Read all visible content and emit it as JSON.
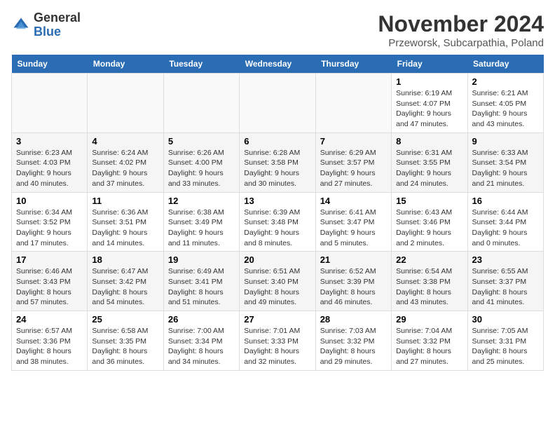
{
  "logo": {
    "general": "General",
    "blue": "Blue"
  },
  "header": {
    "month": "November 2024",
    "location": "Przeworsk, Subcarpathia, Poland"
  },
  "days_of_week": [
    "Sunday",
    "Monday",
    "Tuesday",
    "Wednesday",
    "Thursday",
    "Friday",
    "Saturday"
  ],
  "weeks": [
    [
      {
        "day": "",
        "info": ""
      },
      {
        "day": "",
        "info": ""
      },
      {
        "day": "",
        "info": ""
      },
      {
        "day": "",
        "info": ""
      },
      {
        "day": "",
        "info": ""
      },
      {
        "day": "1",
        "info": "Sunrise: 6:19 AM\nSunset: 4:07 PM\nDaylight: 9 hours and 47 minutes."
      },
      {
        "day": "2",
        "info": "Sunrise: 6:21 AM\nSunset: 4:05 PM\nDaylight: 9 hours and 43 minutes."
      }
    ],
    [
      {
        "day": "3",
        "info": "Sunrise: 6:23 AM\nSunset: 4:03 PM\nDaylight: 9 hours and 40 minutes."
      },
      {
        "day": "4",
        "info": "Sunrise: 6:24 AM\nSunset: 4:02 PM\nDaylight: 9 hours and 37 minutes."
      },
      {
        "day": "5",
        "info": "Sunrise: 6:26 AM\nSunset: 4:00 PM\nDaylight: 9 hours and 33 minutes."
      },
      {
        "day": "6",
        "info": "Sunrise: 6:28 AM\nSunset: 3:58 PM\nDaylight: 9 hours and 30 minutes."
      },
      {
        "day": "7",
        "info": "Sunrise: 6:29 AM\nSunset: 3:57 PM\nDaylight: 9 hours and 27 minutes."
      },
      {
        "day": "8",
        "info": "Sunrise: 6:31 AM\nSunset: 3:55 PM\nDaylight: 9 hours and 24 minutes."
      },
      {
        "day": "9",
        "info": "Sunrise: 6:33 AM\nSunset: 3:54 PM\nDaylight: 9 hours and 21 minutes."
      }
    ],
    [
      {
        "day": "10",
        "info": "Sunrise: 6:34 AM\nSunset: 3:52 PM\nDaylight: 9 hours and 17 minutes."
      },
      {
        "day": "11",
        "info": "Sunrise: 6:36 AM\nSunset: 3:51 PM\nDaylight: 9 hours and 14 minutes."
      },
      {
        "day": "12",
        "info": "Sunrise: 6:38 AM\nSunset: 3:49 PM\nDaylight: 9 hours and 11 minutes."
      },
      {
        "day": "13",
        "info": "Sunrise: 6:39 AM\nSunset: 3:48 PM\nDaylight: 9 hours and 8 minutes."
      },
      {
        "day": "14",
        "info": "Sunrise: 6:41 AM\nSunset: 3:47 PM\nDaylight: 9 hours and 5 minutes."
      },
      {
        "day": "15",
        "info": "Sunrise: 6:43 AM\nSunset: 3:46 PM\nDaylight: 9 hours and 2 minutes."
      },
      {
        "day": "16",
        "info": "Sunrise: 6:44 AM\nSunset: 3:44 PM\nDaylight: 9 hours and 0 minutes."
      }
    ],
    [
      {
        "day": "17",
        "info": "Sunrise: 6:46 AM\nSunset: 3:43 PM\nDaylight: 8 hours and 57 minutes."
      },
      {
        "day": "18",
        "info": "Sunrise: 6:47 AM\nSunset: 3:42 PM\nDaylight: 8 hours and 54 minutes."
      },
      {
        "day": "19",
        "info": "Sunrise: 6:49 AM\nSunset: 3:41 PM\nDaylight: 8 hours and 51 minutes."
      },
      {
        "day": "20",
        "info": "Sunrise: 6:51 AM\nSunset: 3:40 PM\nDaylight: 8 hours and 49 minutes."
      },
      {
        "day": "21",
        "info": "Sunrise: 6:52 AM\nSunset: 3:39 PM\nDaylight: 8 hours and 46 minutes."
      },
      {
        "day": "22",
        "info": "Sunrise: 6:54 AM\nSunset: 3:38 PM\nDaylight: 8 hours and 43 minutes."
      },
      {
        "day": "23",
        "info": "Sunrise: 6:55 AM\nSunset: 3:37 PM\nDaylight: 8 hours and 41 minutes."
      }
    ],
    [
      {
        "day": "24",
        "info": "Sunrise: 6:57 AM\nSunset: 3:36 PM\nDaylight: 8 hours and 38 minutes."
      },
      {
        "day": "25",
        "info": "Sunrise: 6:58 AM\nSunset: 3:35 PM\nDaylight: 8 hours and 36 minutes."
      },
      {
        "day": "26",
        "info": "Sunrise: 7:00 AM\nSunset: 3:34 PM\nDaylight: 8 hours and 34 minutes."
      },
      {
        "day": "27",
        "info": "Sunrise: 7:01 AM\nSunset: 3:33 PM\nDaylight: 8 hours and 32 minutes."
      },
      {
        "day": "28",
        "info": "Sunrise: 7:03 AM\nSunset: 3:32 PM\nDaylight: 8 hours and 29 minutes."
      },
      {
        "day": "29",
        "info": "Sunrise: 7:04 AM\nSunset: 3:32 PM\nDaylight: 8 hours and 27 minutes."
      },
      {
        "day": "30",
        "info": "Sunrise: 7:05 AM\nSunset: 3:31 PM\nDaylight: 8 hours and 25 minutes."
      }
    ]
  ]
}
